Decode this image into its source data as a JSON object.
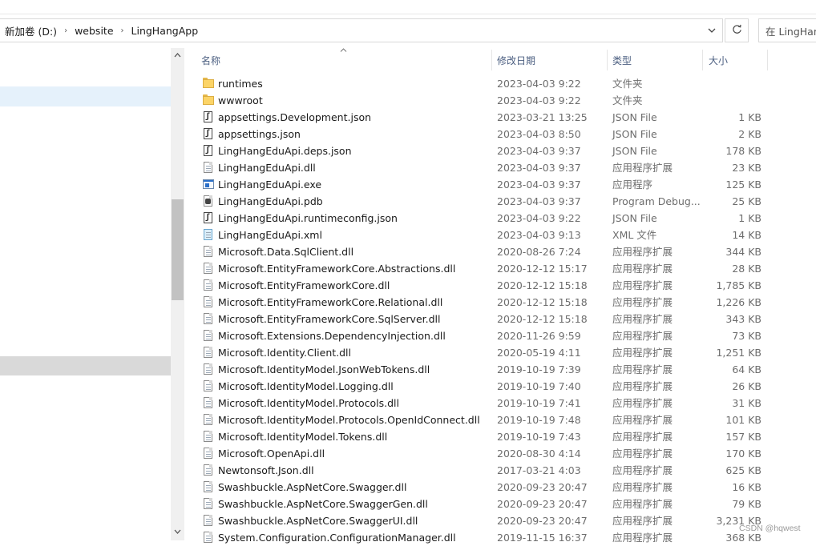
{
  "address": {
    "crumbs": [
      "新加卷 (D:)",
      "website",
      "LingHangApp"
    ],
    "separator": "›"
  },
  "search": {
    "value": "在 LingHan"
  },
  "icons": {
    "dropdown": "chevron-down-icon",
    "refresh": "refresh-icon",
    "sort": "sort-ascending-icon",
    "scroll_up": "scroll-up-icon",
    "scroll_down": "scroll-down-icon"
  },
  "columns": {
    "name": "名称",
    "date": "修改日期",
    "type": "类型",
    "size": "大小"
  },
  "files": [
    {
      "name": "runtimes",
      "date": "2023-04-03 9:22",
      "type": "文件夹",
      "size": "",
      "icon": "folder"
    },
    {
      "name": "wwwroot",
      "date": "2023-04-03 9:22",
      "type": "文件夹",
      "size": "",
      "icon": "folder"
    },
    {
      "name": "appsettings.Development.json",
      "date": "2023-03-21 13:25",
      "type": "JSON File",
      "size": "1 KB",
      "icon": "json"
    },
    {
      "name": "appsettings.json",
      "date": "2023-04-03 8:50",
      "type": "JSON File",
      "size": "2 KB",
      "icon": "json"
    },
    {
      "name": "LingHangEduApi.deps.json",
      "date": "2023-04-03 9:37",
      "type": "JSON File",
      "size": "178 KB",
      "icon": "json"
    },
    {
      "name": "LingHangEduApi.dll",
      "date": "2023-04-03 9:37",
      "type": "应用程序扩展",
      "size": "23 KB",
      "icon": "dll"
    },
    {
      "name": "LingHangEduApi.exe",
      "date": "2023-04-03 9:37",
      "type": "应用程序",
      "size": "125 KB",
      "icon": "exe"
    },
    {
      "name": "LingHangEduApi.pdb",
      "date": "2023-04-03 9:37",
      "type": "Program Debug...",
      "size": "25 KB",
      "icon": "pdb"
    },
    {
      "name": "LingHangEduApi.runtimeconfig.json",
      "date": "2023-04-03 9:22",
      "type": "JSON File",
      "size": "1 KB",
      "icon": "json"
    },
    {
      "name": "LingHangEduApi.xml",
      "date": "2023-04-03 9:13",
      "type": "XML 文件",
      "size": "14 KB",
      "icon": "xml"
    },
    {
      "name": "Microsoft.Data.SqlClient.dll",
      "date": "2020-08-26 7:24",
      "type": "应用程序扩展",
      "size": "344 KB",
      "icon": "dll"
    },
    {
      "name": "Microsoft.EntityFrameworkCore.Abstractions.dll",
      "date": "2020-12-12 15:17",
      "type": "应用程序扩展",
      "size": "28 KB",
      "icon": "dll"
    },
    {
      "name": "Microsoft.EntityFrameworkCore.dll",
      "date": "2020-12-12 15:18",
      "type": "应用程序扩展",
      "size": "1,785 KB",
      "icon": "dll"
    },
    {
      "name": "Microsoft.EntityFrameworkCore.Relational.dll",
      "date": "2020-12-12 15:18",
      "type": "应用程序扩展",
      "size": "1,226 KB",
      "icon": "dll"
    },
    {
      "name": "Microsoft.EntityFrameworkCore.SqlServer.dll",
      "date": "2020-12-12 15:18",
      "type": "应用程序扩展",
      "size": "343 KB",
      "icon": "dll"
    },
    {
      "name": "Microsoft.Extensions.DependencyInjection.dll",
      "date": "2020-11-26 9:59",
      "type": "应用程序扩展",
      "size": "73 KB",
      "icon": "dll"
    },
    {
      "name": "Microsoft.Identity.Client.dll",
      "date": "2020-05-19 4:11",
      "type": "应用程序扩展",
      "size": "1,251 KB",
      "icon": "dll"
    },
    {
      "name": "Microsoft.IdentityModel.JsonWebTokens.dll",
      "date": "2019-10-19 7:39",
      "type": "应用程序扩展",
      "size": "64 KB",
      "icon": "dll"
    },
    {
      "name": "Microsoft.IdentityModel.Logging.dll",
      "date": "2019-10-19 7:40",
      "type": "应用程序扩展",
      "size": "26 KB",
      "icon": "dll"
    },
    {
      "name": "Microsoft.IdentityModel.Protocols.dll",
      "date": "2019-10-19 7:41",
      "type": "应用程序扩展",
      "size": "31 KB",
      "icon": "dll"
    },
    {
      "name": "Microsoft.IdentityModel.Protocols.OpenIdConnect.dll",
      "date": "2019-10-19 7:48",
      "type": "应用程序扩展",
      "size": "101 KB",
      "icon": "dll"
    },
    {
      "name": "Microsoft.IdentityModel.Tokens.dll",
      "date": "2019-10-19 7:43",
      "type": "应用程序扩展",
      "size": "157 KB",
      "icon": "dll"
    },
    {
      "name": "Microsoft.OpenApi.dll",
      "date": "2020-08-30 4:14",
      "type": "应用程序扩展",
      "size": "170 KB",
      "icon": "dll"
    },
    {
      "name": "Newtonsoft.Json.dll",
      "date": "2017-03-21 4:03",
      "type": "应用程序扩展",
      "size": "625 KB",
      "icon": "dll"
    },
    {
      "name": "Swashbuckle.AspNetCore.Swagger.dll",
      "date": "2020-09-23 20:47",
      "type": "应用程序扩展",
      "size": "16 KB",
      "icon": "dll"
    },
    {
      "name": "Swashbuckle.AspNetCore.SwaggerGen.dll",
      "date": "2020-09-23 20:47",
      "type": "应用程序扩展",
      "size": "79 KB",
      "icon": "dll"
    },
    {
      "name": "Swashbuckle.AspNetCore.SwaggerUI.dll",
      "date": "2020-09-23 20:47",
      "type": "应用程序扩展",
      "size": "3,231 KB",
      "icon": "dll"
    },
    {
      "name": "System.Configuration.ConfigurationManager.dll",
      "date": "2019-11-15 16:37",
      "type": "应用程序扩展",
      "size": "368 KB",
      "icon": "dll"
    }
  ],
  "watermark": "CSDN @hqwest"
}
